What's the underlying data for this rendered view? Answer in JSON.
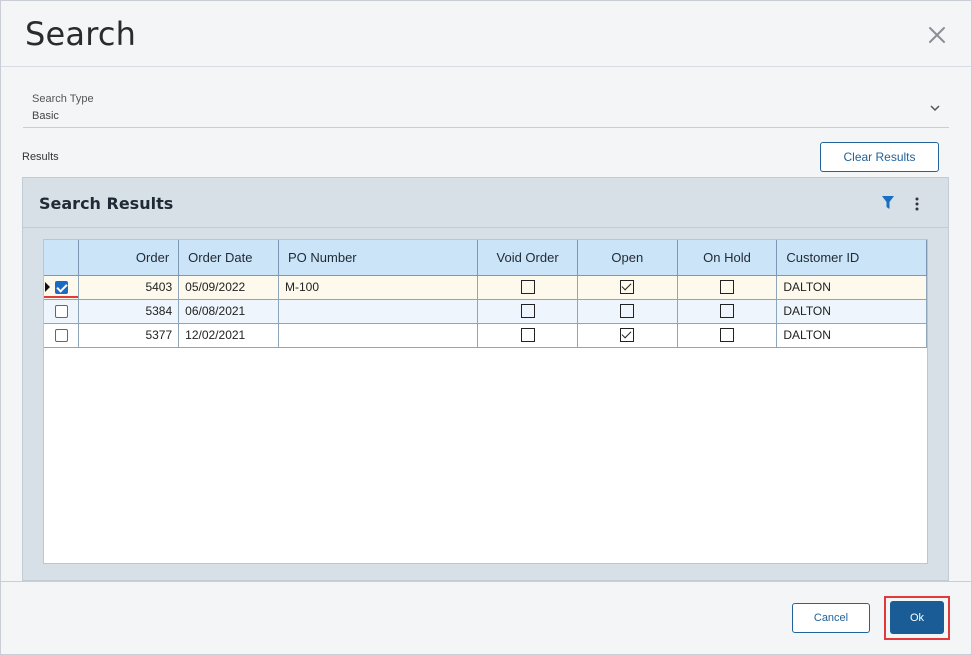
{
  "dialog": {
    "title": "Search",
    "close_icon": "close-icon"
  },
  "search_type": {
    "label": "Search Type",
    "value": "Basic",
    "icon": "chevron-down-icon"
  },
  "results": {
    "label": "Results",
    "clear_label": "Clear Results"
  },
  "panel": {
    "title": "Search Results",
    "icons": [
      "filter-icon",
      "more-vertical-icon"
    ]
  },
  "grid": {
    "columns": [
      "",
      "Order",
      "Order Date",
      "PO Number",
      "Void Order",
      "Open",
      "On Hold",
      "Customer ID"
    ],
    "rows": [
      {
        "selected": true,
        "order": "5403",
        "order_date": "05/09/2022",
        "po_number": "M-100",
        "void_order": false,
        "open": true,
        "on_hold": false,
        "customer_id": "DALTON"
      },
      {
        "selected": false,
        "order": "5384",
        "order_date": "06/08/2021",
        "po_number": "",
        "void_order": false,
        "open": false,
        "on_hold": false,
        "customer_id": "DALTON"
      },
      {
        "selected": false,
        "order": "5377",
        "order_date": "12/02/2021",
        "po_number": "",
        "void_order": false,
        "open": true,
        "on_hold": false,
        "customer_id": "DALTON"
      }
    ]
  },
  "footer": {
    "cancel_label": "Cancel",
    "ok_label": "Ok"
  },
  "colors": {
    "accent": "#1a5c96",
    "header_bg": "#cbe4f7",
    "selected_row": "#fdf9ec",
    "highlight": "#e03a3a"
  }
}
